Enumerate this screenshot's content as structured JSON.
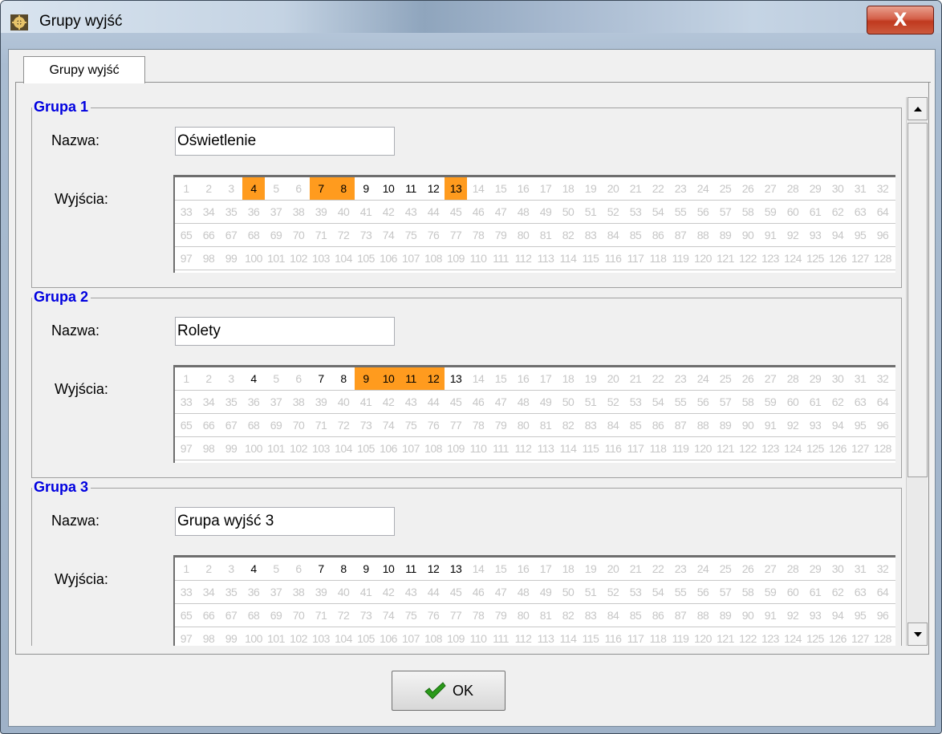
{
  "window": {
    "title": "Grupy wyjść",
    "close_label": "X"
  },
  "tabs": [
    {
      "label": "Grupy wyjść",
      "active": true
    }
  ],
  "groups": [
    {
      "title": "Grupa 1",
      "name_label": "Nazwa:",
      "name_value": "Oświetlenie",
      "outputs_label": "Wyjścia:",
      "enabled": [
        4,
        7,
        8,
        9,
        10,
        11,
        12,
        13
      ],
      "selected": [
        4,
        7,
        8,
        13
      ]
    },
    {
      "title": "Grupa 2",
      "name_label": "Nazwa:",
      "name_value": "Rolety",
      "outputs_label": "Wyjścia:",
      "enabled": [
        4,
        7,
        8,
        9,
        10,
        11,
        12,
        13
      ],
      "selected": [
        9,
        10,
        11,
        12
      ]
    },
    {
      "title": "Grupa 3",
      "name_label": "Nazwa:",
      "name_value": "Grupa wyjść 3",
      "outputs_label": "Wyjścia:",
      "enabled": [
        4,
        7,
        8,
        9,
        10,
        11,
        12,
        13
      ],
      "selected": []
    }
  ],
  "outputs_total": 128,
  "outputs_per_row": 32,
  "footer": {
    "ok_label": "OK"
  },
  "colors": {
    "selected_output": "#ff9b1e",
    "group_title": "#0000e0",
    "disabled_output_text": "#c6c6c6"
  },
  "icons": {
    "app": "app-icon",
    "close": "close-icon",
    "ok": "checkmark-icon",
    "scroll_up": "arrow-up-icon",
    "scroll_down": "arrow-down-icon"
  }
}
